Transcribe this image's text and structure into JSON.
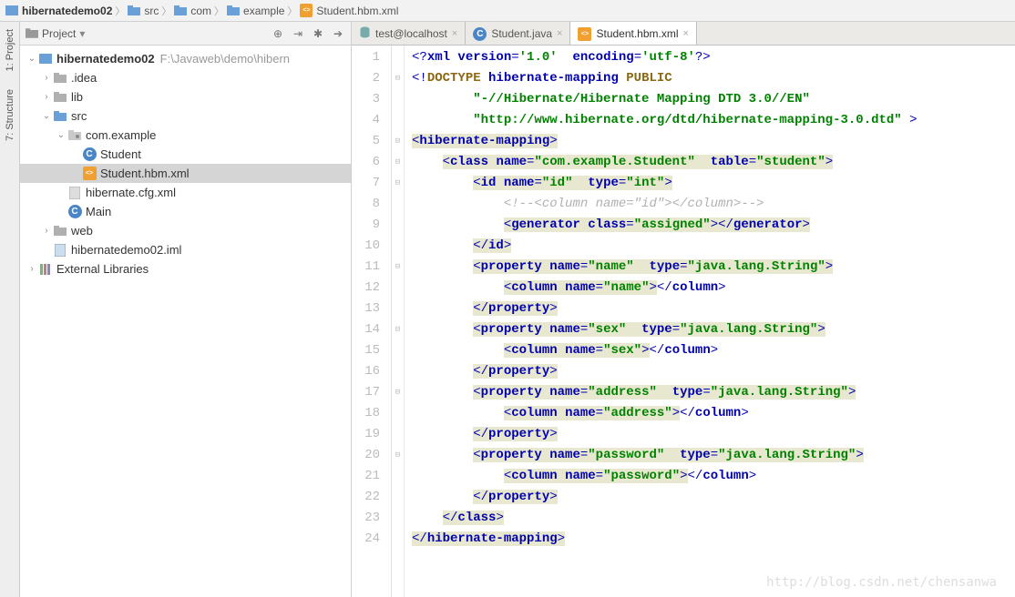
{
  "breadcrumb": [
    {
      "icon": "module",
      "label": "hibernatedemo02",
      "bold": true
    },
    {
      "icon": "folder",
      "label": "src"
    },
    {
      "icon": "folder",
      "label": "com"
    },
    {
      "icon": "folder",
      "label": "example"
    },
    {
      "icon": "xml",
      "label": "Student.hbm.xml"
    }
  ],
  "panel": {
    "title": "Project"
  },
  "leftbar": [
    "1: Project",
    "7: Structure"
  ],
  "tree": [
    {
      "depth": 0,
      "arrow": "v",
      "icon": "module",
      "label": "hibernatedemo02",
      "bold": true,
      "hint": "F:\\Javaweb\\demo\\hibern"
    },
    {
      "depth": 1,
      "arrow": ">",
      "icon": "folder-dim",
      "label": ".idea"
    },
    {
      "depth": 1,
      "arrow": ">",
      "icon": "folder-dim",
      "label": "lib"
    },
    {
      "depth": 1,
      "arrow": "v",
      "icon": "folder-src",
      "label": "src"
    },
    {
      "depth": 2,
      "arrow": "v",
      "icon": "package",
      "label": "com.example"
    },
    {
      "depth": 3,
      "arrow": "",
      "icon": "class",
      "label": "Student"
    },
    {
      "depth": 3,
      "arrow": "",
      "icon": "xml",
      "label": "Student.hbm.xml",
      "selected": true
    },
    {
      "depth": 2,
      "arrow": "",
      "icon": "file",
      "label": "hibernate.cfg.xml"
    },
    {
      "depth": 2,
      "arrow": "",
      "icon": "class",
      "label": "Main"
    },
    {
      "depth": 1,
      "arrow": ">",
      "icon": "folder-dim",
      "label": "web"
    },
    {
      "depth": 1,
      "arrow": "",
      "icon": "iml",
      "label": "hibernatedemo02.iml"
    },
    {
      "depth": 0,
      "arrow": ">",
      "icon": "libs",
      "label": "External Libraries"
    }
  ],
  "tabs": [
    {
      "icon": "db",
      "label": "test@localhost",
      "active": false
    },
    {
      "icon": "class",
      "label": "Student.java",
      "active": false
    },
    {
      "icon": "xml",
      "label": "Student.hbm.xml",
      "active": true
    }
  ],
  "code": {
    "lines": [
      {
        "n": 1,
        "fold": "",
        "html": "<span class='xml-br'>&lt;?</span><span class='xml-tag'>xml version</span><span class='xml-br'>=</span><span class='xml-val'>'1.0'</span>  <span class='xml-tag'>encoding</span><span class='xml-br'>=</span><span class='xml-val'>'utf-8'</span><span class='xml-br'>?&gt;</span>"
      },
      {
        "n": 2,
        "fold": "-",
        "html": "<span class='xml-br'>&lt;!</span><span class='xml-doctype'>DOCTYPE</span> <span class='xml-tag'>hibernate-mapping</span> <span class='xml-doctype'>PUBLIC</span>"
      },
      {
        "n": 3,
        "fold": "",
        "html": "        <span class='xml-str'>\"-//Hibernate/Hibernate Mapping DTD 3.0//EN\"</span>"
      },
      {
        "n": 4,
        "fold": "",
        "html": "        <span class='xml-str'>\"http://www.hibernate.org/dtd/hibernate-mapping-3.0.dtd\"</span> <span class='xml-br'>&gt;</span>"
      },
      {
        "n": 5,
        "fold": "-",
        "html": "<span class='hl'><span class='xml-br'>&lt;</span><span class='xml-tag'>hibernate-mapping</span><span class='xml-br'>&gt;</span></span>"
      },
      {
        "n": 6,
        "fold": "-",
        "html": "    <span class='hl'><span class='xml-br'>&lt;</span><span class='xml-tag'>class</span> <span class='xml-attr'>name</span><span class='xml-br'>=</span><span class='xml-val'>\"com.example.Student\"</span>  <span class='xml-attr'>table</span><span class='xml-br'>=</span><span class='xml-val'>\"student\"</span><span class='xml-br'>&gt;</span></span>"
      },
      {
        "n": 7,
        "fold": "-",
        "html": "        <span class='hl'><span class='xml-br'>&lt;</span><span class='xml-tag'>id</span> <span class='xml-attr'>name</span><span class='xml-br'>=</span><span class='xml-val'>\"id\"</span>  <span class='xml-attr'>type</span><span class='xml-br'>=</span><span class='xml-val'>\"int\"</span><span class='xml-br'>&gt;</span></span>"
      },
      {
        "n": 8,
        "fold": "",
        "html": "            <span class='xml-comment'>&lt;!--&lt;column name=\"id\"&gt;&lt;/column&gt;--&gt;</span>"
      },
      {
        "n": 9,
        "fold": "",
        "html": "            <span class='hl'><span class='xml-br'>&lt;</span><span class='xml-tag'>generator</span> <span class='xml-attr'>class</span><span class='xml-br'>=</span><span class='xml-val'>\"assigned\"</span><span class='xml-br'>&gt;&lt;/</span><span class='xml-tag'>generator</span><span class='xml-br'>&gt;</span></span>"
      },
      {
        "n": 10,
        "fold": "",
        "html": "        <span class='hl'><span class='xml-br'>&lt;/</span><span class='xml-tag'>id</span><span class='xml-br'>&gt;</span></span>"
      },
      {
        "n": 11,
        "fold": "-",
        "html": "        <span class='hl'><span class='xml-br'>&lt;</span><span class='xml-tag'>property</span> <span class='xml-attr'>name</span><span class='xml-br'>=</span><span class='xml-val'>\"name\"</span>  <span class='xml-attr'>type</span><span class='xml-br'>=</span><span class='xml-val'>\"java.lang.String\"</span><span class='xml-br'>&gt;</span></span>"
      },
      {
        "n": 12,
        "fold": "",
        "html": "            <span class='hl'><span class='xml-br'>&lt;</span><span class='xml-tag'>column</span> <span class='xml-attr'>name</span><span class='xml-br'>=</span><span class='xml-val'>\"name\"</span><span class='xml-br'>&gt;</span></span><span class='xml-br'>&lt;/</span><span class='xml-tag'>column</span><span class='xml-br'>&gt;</span>"
      },
      {
        "n": 13,
        "fold": "",
        "html": "        <span class='hl'><span class='xml-br'>&lt;/</span><span class='xml-tag'>property</span><span class='xml-br'>&gt;</span></span>"
      },
      {
        "n": 14,
        "fold": "-",
        "html": "        <span class='hl'><span class='xml-br'>&lt;</span><span class='xml-tag'>property</span> <span class='xml-attr'>name</span><span class='xml-br'>=</span><span class='xml-val'>\"sex\"</span>  <span class='xml-attr'>type</span><span class='xml-br'>=</span><span class='xml-val'>\"java.lang.String\"</span><span class='xml-br'>&gt;</span></span>"
      },
      {
        "n": 15,
        "fold": "",
        "html": "            <span class='hl'><span class='xml-br'>&lt;</span><span class='xml-tag'>column</span> <span class='xml-attr'>name</span><span class='xml-br'>=</span><span class='xml-val'>\"sex\"</span><span class='xml-br'>&gt;</span></span><span class='xml-br'>&lt;/</span><span class='xml-tag'>column</span><span class='xml-br'>&gt;</span>"
      },
      {
        "n": 16,
        "fold": "",
        "html": "        <span class='hl'><span class='xml-br'>&lt;/</span><span class='xml-tag'>property</span><span class='xml-br'>&gt;</span></span>"
      },
      {
        "n": 17,
        "fold": "-",
        "html": "        <span class='hl'><span class='xml-br'>&lt;</span><span class='xml-tag'>property</span> <span class='xml-attr'>name</span><span class='xml-br'>=</span><span class='xml-val'>\"address\"</span>  <span class='xml-attr'>type</span><span class='xml-br'>=</span><span class='xml-val'>\"java.lang.String\"</span><span class='xml-br'>&gt;</span></span>"
      },
      {
        "n": 18,
        "fold": "",
        "html": "            <span class='hl'><span class='xml-br'>&lt;</span><span class='xml-tag'>column</span> <span class='xml-attr'>name</span><span class='xml-br'>=</span><span class='xml-val'>\"address\"</span><span class='xml-br'>&gt;</span></span><span class='xml-br'>&lt;/</span><span class='xml-tag'>column</span><span class='xml-br'>&gt;</span>"
      },
      {
        "n": 19,
        "fold": "",
        "html": "        <span class='hl'><span class='xml-br'>&lt;/</span><span class='xml-tag'>property</span><span class='xml-br'>&gt;</span></span>"
      },
      {
        "n": 20,
        "fold": "-",
        "html": "        <span class='hl'><span class='xml-br'>&lt;</span><span class='xml-tag'>property</span> <span class='xml-attr'>name</span><span class='xml-br'>=</span><span class='xml-val'>\"password\"</span>  <span class='xml-attr'>type</span><span class='xml-br'>=</span><span class='xml-val'>\"java.lang.String\"</span><span class='xml-br'>&gt;</span></span>"
      },
      {
        "n": 21,
        "fold": "",
        "html": "            <span class='hl'><span class='xml-br'>&lt;</span><span class='xml-tag'>column</span> <span class='xml-attr'>name</span><span class='xml-br'>=</span><span class='xml-val'>\"password\"</span><span class='xml-br'>&gt;</span></span><span class='xml-br'>&lt;/</span><span class='xml-tag'>column</span><span class='xml-br'>&gt;</span>"
      },
      {
        "n": 22,
        "fold": "",
        "html": "        <span class='hl'><span class='xml-br'>&lt;/</span><span class='xml-tag'>property</span><span class='xml-br'>&gt;</span></span>"
      },
      {
        "n": 23,
        "fold": "",
        "html": "    <span class='hl'><span class='xml-br'>&lt;/</span><span class='xml-tag'>class</span><span class='xml-br'>&gt;</span></span>"
      },
      {
        "n": 24,
        "fold": "",
        "html": "<span class='hl'><span class='xml-br'>&lt;/</span><span class='xml-tag'>hibernate-mapping</span><span class='xml-br'>&gt;</span></span>"
      }
    ]
  },
  "watermark": "http://blog.csdn.net/chensanwa"
}
